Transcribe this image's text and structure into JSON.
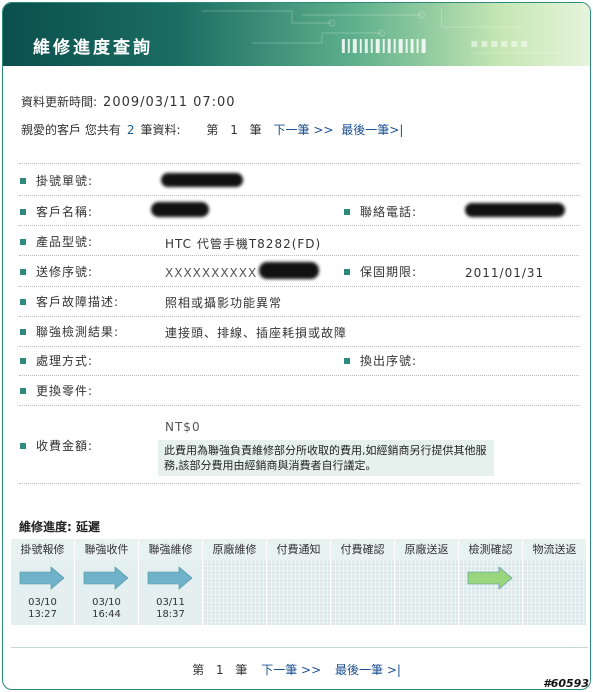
{
  "header": {
    "title": "維修進度查詢"
  },
  "update": {
    "label": "資料更新時間:",
    "value": "2009/03/11 07:00"
  },
  "summary": {
    "prefix": "親愛的客戶 您共有",
    "count": "2",
    "suffix": "筆資料:",
    "page_prefix": "第",
    "page": "1",
    "page_suffix": "筆",
    "next": "下一筆 >>",
    "last": "最後一筆>|"
  },
  "fields": {
    "ticket_label": "掛號單號:",
    "customer_label": "客戶名稱:",
    "phone_label": "聯絡電話:",
    "model_label": "產品型號:",
    "model_value": "HTC 代管手機T8282(FD)",
    "serial_label": "送修序號:",
    "serial_value": "XXXXXXXXXX",
    "warranty_label": "保固期限:",
    "warranty_value": "2011/01/31",
    "fault_label": "客戶故障描述:",
    "fault_value": "照相或攝影功能異常",
    "inspect_label": "聯強檢測結果:",
    "inspect_value": "連接頭、排線、插座耗損或故障",
    "handling_label": "處理方式:",
    "swap_label": "換出序號:",
    "parts_label": "更換零件:",
    "fee_label": "收費金額:",
    "fee_value": "NT$0",
    "fee_note": "此費用為聯強負責維修部分所收取的費用,如經銷商另行提供其他服務,該部分費用由經銷商與消費者自行議定。"
  },
  "progress": {
    "title": "維修進度: 延遲",
    "steps": [
      {
        "label": "掛號報修",
        "date": "03/10",
        "time": "13:27"
      },
      {
        "label": "聯強收件",
        "date": "03/10",
        "time": "16:44"
      },
      {
        "label": "聯強維修",
        "date": "03/11",
        "time": "18:37"
      },
      {
        "label": "原廠維修",
        "date": "",
        "time": ""
      },
      {
        "label": "付費通知",
        "date": "",
        "time": ""
      },
      {
        "label": "付費確認",
        "date": "",
        "time": ""
      },
      {
        "label": "原廠送返",
        "date": "",
        "time": ""
      },
      {
        "label": "檢測確認",
        "date": "",
        "time": ""
      },
      {
        "label": "物流送返",
        "date": "",
        "time": ""
      }
    ]
  },
  "pager": {
    "prefix": "第",
    "page": "1",
    "suffix": "筆",
    "next": "下一筆 >>",
    "last": "最後一筆 >|"
  },
  "watermark": "#60593",
  "colors": {
    "accent": "#2e8a7c",
    "link": "#1a4f8f",
    "arrow_blue": "#6fb2c9",
    "arrow_green": "#9ad67e"
  }
}
